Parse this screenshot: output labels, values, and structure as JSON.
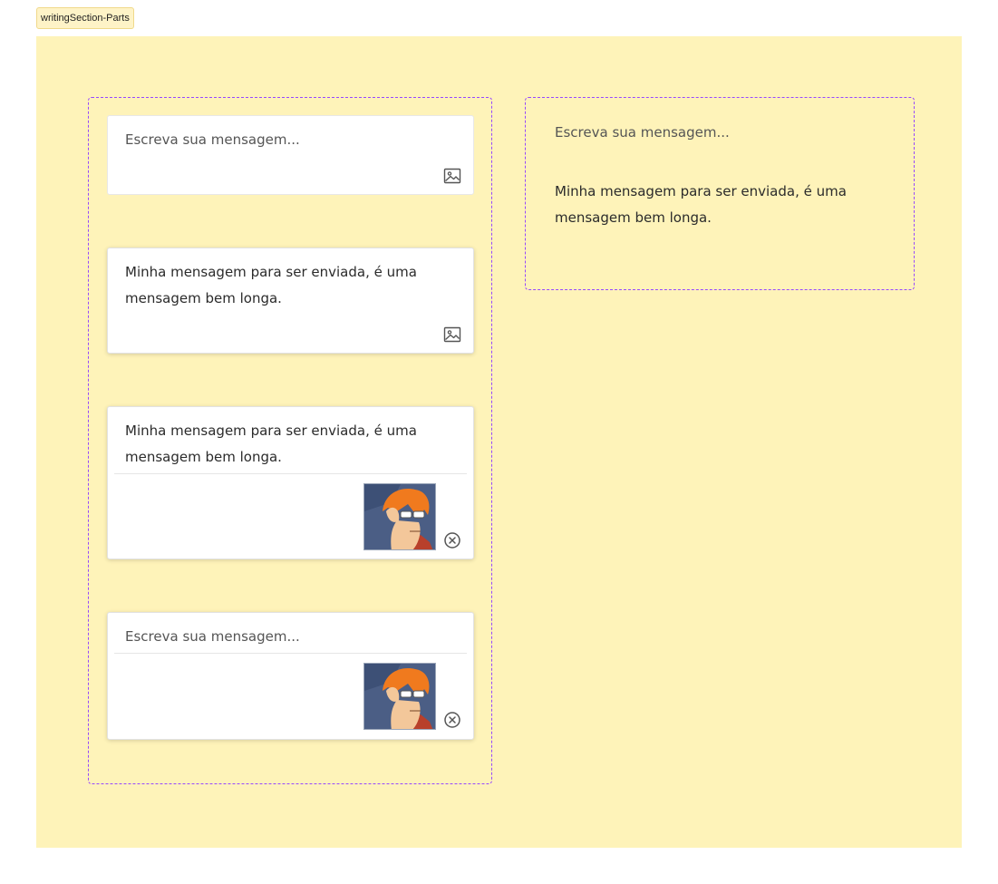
{
  "frame": {
    "label": "writingSection-Parts"
  },
  "cards": {
    "empty_placeholder": "Escreva sua mensagem...",
    "filled_text": "Minha mensagem para ser enviada, é uma mensagem bem longa.",
    "with_image_text": "Minha mensagem para ser enviada, é uma mensagem bem longa.",
    "empty_with_image_placeholder": "Escreva sua mensagem..."
  },
  "parts": {
    "placeholder": "Escreva sua mensagem...",
    "text": "Minha mensagem para ser enviada, é uma mensagem bem longa."
  },
  "icons": {
    "attach": "image-icon",
    "remove": "close-circle-icon"
  },
  "colors": {
    "canvas": "#fef3b9",
    "group_border": "#9747ff",
    "card_bg": "#ffffff",
    "text": "#2b2b2b"
  }
}
